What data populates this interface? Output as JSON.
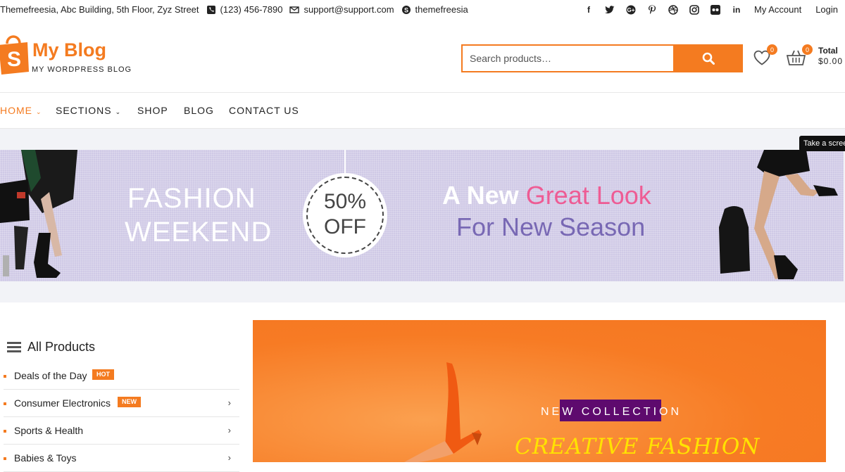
{
  "topbar": {
    "address": "Themefreesia, Abc Building, 5th Floor, Zyz Street",
    "phone": "(123) 456-7890",
    "email": "support@support.com",
    "skype": "themefreesia",
    "social_icons": [
      "facebook-icon",
      "twitter-icon",
      "google-plus-icon",
      "pinterest-icon",
      "dribbble-icon",
      "instagram-icon",
      "flickr-icon",
      "linkedin-icon"
    ],
    "my_account": "My Account",
    "login": "Login"
  },
  "header": {
    "logo_letter": "S",
    "site_title": "My Blog",
    "tagline": "MY WORDPRESS BLOG",
    "search_placeholder": "Search products…",
    "wishlist_count": "0",
    "cart_count": "0",
    "total_label": "Total",
    "total_amount": "$0.00"
  },
  "nav": {
    "items": [
      {
        "label": "HOME"
      },
      {
        "label": "SECTIONS"
      },
      {
        "label": "SHOP"
      },
      {
        "label": "BLOG"
      },
      {
        "label": "CONTACT US"
      }
    ]
  },
  "tooltip": "Take a screenshot",
  "banner": {
    "line1": "FASHION",
    "line2": "WEEKEND",
    "discount_top": "50%",
    "discount_bottom": "OFF",
    "headline_a": "A New ",
    "headline_b": "Great Look",
    "headline_c": "For New Season"
  },
  "categories": {
    "title": "All Products",
    "items": [
      {
        "label": "Deals of the Day",
        "badge": "HOT"
      },
      {
        "label": "Consumer Electronics",
        "badge": "NEW"
      },
      {
        "label": "Sports & Health"
      },
      {
        "label": "Babies & Toys"
      }
    ]
  },
  "hero": {
    "subtitle": "NEW COLLECTION",
    "title": "CREATIVE FASHION"
  },
  "colors": {
    "accent": "#f47b20",
    "banner_bg": "#cfc9e6",
    "highlight_pink": "#ee5c94",
    "headline_purple": "#7868b4",
    "hero_title": "#ffe200",
    "selection": "#5e0a6e"
  }
}
